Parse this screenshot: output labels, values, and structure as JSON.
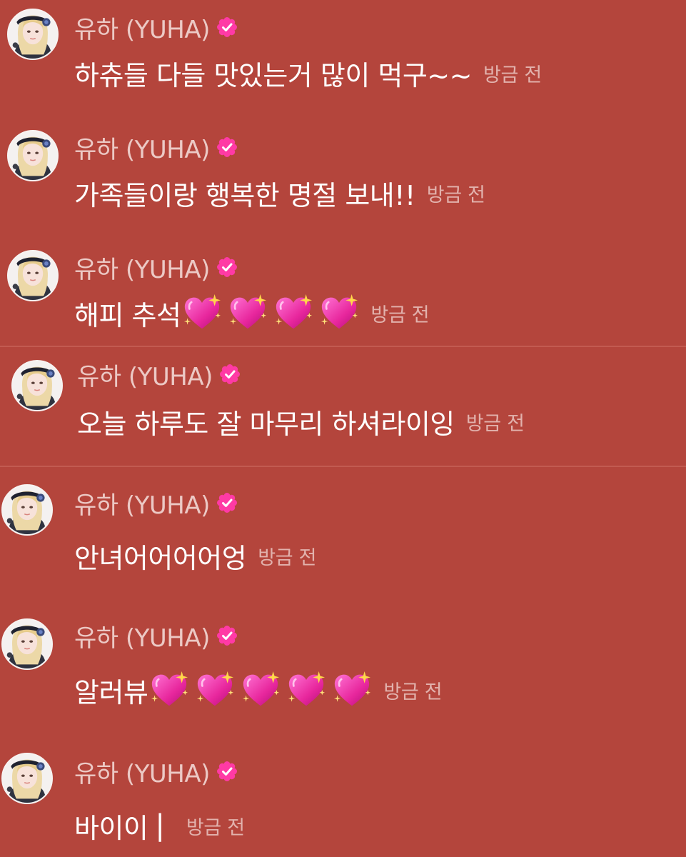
{
  "colors": {
    "background": "#b4453c",
    "sender": "#ecc9c5",
    "text": "#ffffff",
    "time": "#e2b2ad",
    "badge": "#ff3aa5"
  },
  "icons": {
    "avatar": "profile-photo",
    "badge": "verified-flower-badge",
    "emoji": "sparkling-heart"
  },
  "messages": [
    {
      "sender": "유하 (YUHA)",
      "text": "하츄들 다들 맛있는거 많이 먹구~~",
      "hearts": 0,
      "time": "방금 전"
    },
    {
      "sender": "유하 (YUHA)",
      "text": "가족들이랑 행복한 명절 보내!!",
      "hearts": 0,
      "time": "방금 전"
    },
    {
      "sender": "유하 (YUHA)",
      "text": "해피 추석",
      "hearts": 4,
      "time": "방금 전"
    },
    {
      "sender": "유하 (YUHA)",
      "text": "오늘 하루도 잘 마무리 하셔라이잉",
      "hearts": 0,
      "time": "방금 전"
    },
    {
      "sender": "유하 (YUHA)",
      "text": "안녀어어어어엉",
      "hearts": 0,
      "time": "방금 전"
    },
    {
      "sender": "유하 (YUHA)",
      "text": "알러뷰",
      "hearts": 5,
      "time": "방금 전"
    },
    {
      "sender": "유하 (YUHA)",
      "text": "바이이",
      "hearts": 0,
      "time": "방금 전",
      "cursor": "|"
    }
  ]
}
